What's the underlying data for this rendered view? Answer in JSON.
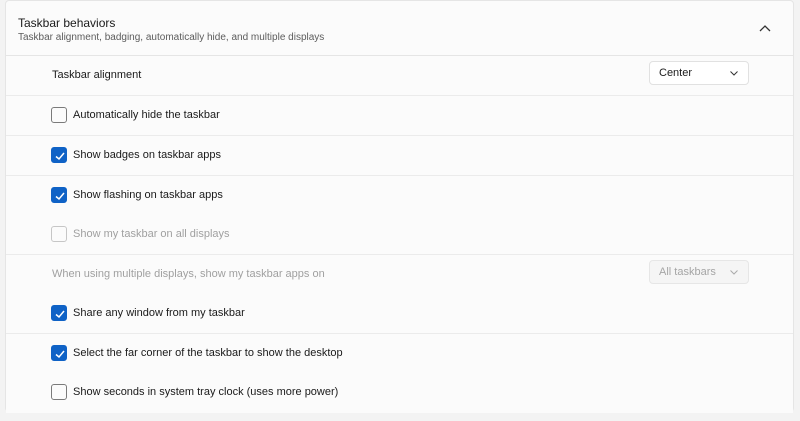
{
  "section": {
    "title": "Taskbar behaviors",
    "subtitle": "Taskbar alignment, badging, automatically hide, and multiple displays",
    "expanded": true
  },
  "settings": {
    "alignment": {
      "label": "Taskbar alignment",
      "value": "Center"
    },
    "auto_hide": {
      "label": "Automatically hide the taskbar",
      "checked": false
    },
    "badges": {
      "label": "Show badges on taskbar apps",
      "checked": true
    },
    "flashing": {
      "label": "Show flashing on taskbar apps",
      "checked": true
    },
    "all_displays": {
      "label": "Show my taskbar on all displays",
      "checked": false,
      "disabled": true
    },
    "multi_display": {
      "label": "When using multiple displays, show my taskbar apps on",
      "value": "All taskbars",
      "disabled": true
    },
    "share_window": {
      "label": "Share any window from my taskbar",
      "checked": true
    },
    "far_corner": {
      "label": "Select the far corner of the taskbar to show the desktop",
      "checked": true
    },
    "seconds": {
      "label": "Show seconds in system tray clock (uses more power)",
      "checked": false
    }
  },
  "colors": {
    "accent": "#0f62c6",
    "panel": "#fbfbfb",
    "background": "#f3f3f3"
  }
}
